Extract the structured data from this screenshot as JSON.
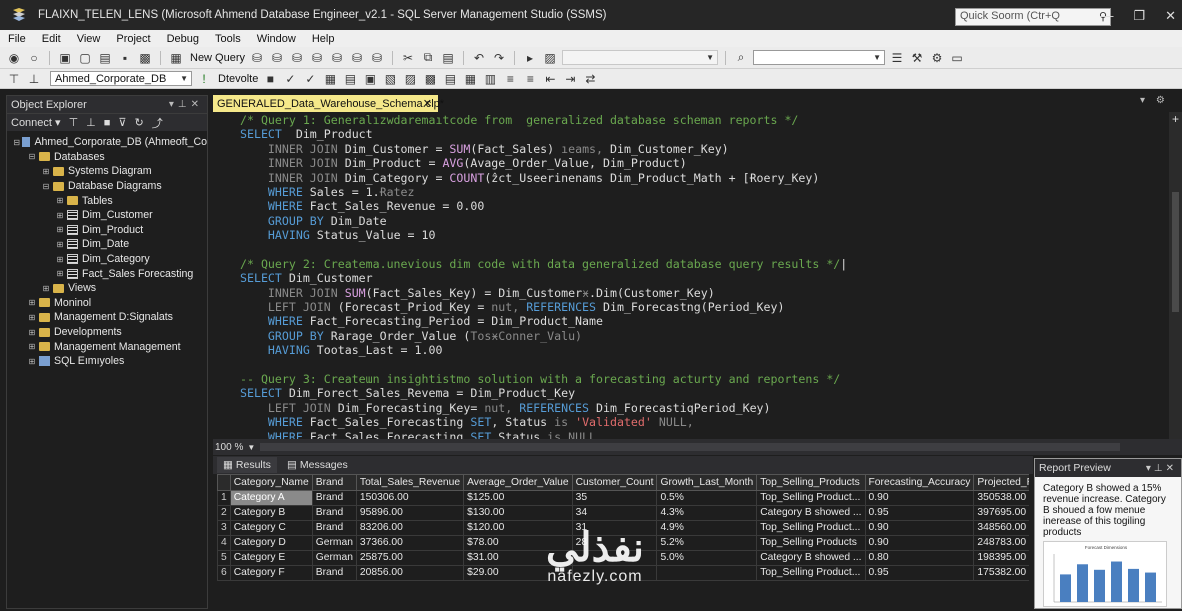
{
  "window": {
    "title": "FLAIXN_TELEN_LENS (Microsoft Ahmend Database Engineer_v2.1 - SQL Server Management Studio (SSMS)",
    "quick_launch_placeholder": "Quick Soorm (Ctr+Q",
    "controls": [
      "—",
      "❐",
      "✕"
    ]
  },
  "menu": [
    "File",
    "Edit",
    "View",
    "Project",
    "Debug",
    "Tools",
    "Window",
    "Help"
  ],
  "toolbar": {
    "new_query_label": "New Query",
    "database": "Ahmed_Corporate_DB",
    "execute_label": "Dtevolte"
  },
  "object_explorer": {
    "title": "Object Explorer",
    "connect_label": "Connect",
    "tree": [
      {
        "level": 0,
        "toggle": "⊟",
        "icon": "server",
        "label": "Ahmed_Corporate_DB (Ahmeoft_Co"
      },
      {
        "level": 1,
        "toggle": "⊟",
        "icon": "folder",
        "label": "Databases"
      },
      {
        "level": 2,
        "toggle": "⊞",
        "icon": "folder",
        "label": "Systems Diagram"
      },
      {
        "level": 2,
        "toggle": "⊟",
        "icon": "folder",
        "label": "Database Diagrams"
      },
      {
        "level": 3,
        "toggle": "⊞",
        "icon": "folder",
        "label": "Tables"
      },
      {
        "level": 3,
        "toggle": "⊞",
        "icon": "table",
        "label": "Dim_Customer"
      },
      {
        "level": 3,
        "toggle": "⊞",
        "icon": "table",
        "label": "Dim_Product"
      },
      {
        "level": 3,
        "toggle": "⊞",
        "icon": "table",
        "label": "Dim_Date"
      },
      {
        "level": 3,
        "toggle": "⊞",
        "icon": "table",
        "label": "Dim_Category"
      },
      {
        "level": 3,
        "toggle": "⊞",
        "icon": "table",
        "label": "Fact_Sales Forecasting"
      },
      {
        "level": 2,
        "toggle": "⊞",
        "icon": "folder",
        "label": "Views"
      },
      {
        "level": 1,
        "toggle": "⊞",
        "icon": "folder",
        "label": "Moninol"
      },
      {
        "level": 1,
        "toggle": "⊞",
        "icon": "folder",
        "label": "Management D:Signalats"
      },
      {
        "level": 1,
        "toggle": "⊞",
        "icon": "folder",
        "label": "Developments"
      },
      {
        "level": 1,
        "toggle": "⊞",
        "icon": "folder",
        "label": "Management Management"
      },
      {
        "level": 1,
        "toggle": "⊞",
        "icon": "sql",
        "label": "SQL Eımıyoles"
      }
    ]
  },
  "editor": {
    "tab_label": "GENERALED_Data_Warehouse_Schema.clp*",
    "tab_close": "✕",
    "zoom": "100 %",
    "lines": [
      [
        [
          "c-com",
          "/* Query 1: Generalızwdaremaıtcode from  generalized database scheman reports */"
        ]
      ],
      [
        [
          "c-kw",
          "SELECT"
        ],
        [
          "",
          "  Dim_Product"
        ]
      ],
      [
        [
          "",
          "    "
        ],
        [
          "c-gray",
          "INNER JOIN"
        ],
        [
          "",
          " Dim_Customer = "
        ],
        [
          "c-fn",
          "SUM"
        ],
        [
          "",
          "(Fact_Sales) "
        ],
        [
          "c-gray",
          "ıeams, "
        ],
        [
          "",
          "Dim_Customer_Key)"
        ]
      ],
      [
        [
          "",
          "    "
        ],
        [
          "c-gray",
          "INNER JOIN"
        ],
        [
          "",
          " Dim_Product = "
        ],
        [
          "c-fn",
          "AVG"
        ],
        [
          "",
          "(Avage_Order_Value, Dim_Product)"
        ]
      ],
      [
        [
          "",
          "    "
        ],
        [
          "c-gray",
          "INNER JOIN"
        ],
        [
          "",
          " Dim_Category = "
        ],
        [
          "c-fn",
          "COUNT"
        ],
        [
          "",
          "(ẑct_Useerinenams Dim_Product_Math + [Ɍoery_Key)"
        ]
      ],
      [
        [
          "",
          "    "
        ],
        [
          "c-kw",
          "WHERE"
        ],
        [
          "",
          " Sales = 1."
        ],
        [
          "c-gray",
          "Ɍatez"
        ]
      ],
      [
        [
          "",
          "    "
        ],
        [
          "c-kw",
          "WHERE"
        ],
        [
          "",
          " Fact_Sales_Revenue = 0.00"
        ]
      ],
      [
        [
          "",
          "    "
        ],
        [
          "c-kw",
          "GROUP BY"
        ],
        [
          "",
          " Dim_Date"
        ]
      ],
      [
        [
          "",
          "    "
        ],
        [
          "c-kw",
          "HAVING"
        ],
        [
          "",
          " Status_Value = 10"
        ]
      ],
      [
        [
          "",
          ""
        ]
      ],
      [
        [
          "c-com",
          "/* Query 2: Createma.unevious dim code with data generalized database query results */"
        ],
        [
          "",
          "|"
        ]
      ],
      [
        [
          "c-kw",
          "SELECT"
        ],
        [
          "",
          " Dim_Customer"
        ]
      ],
      [
        [
          "",
          "    "
        ],
        [
          "c-gray",
          "INNER JOIN"
        ],
        [
          "",
          " "
        ],
        [
          "c-fn",
          "SUM"
        ],
        [
          "",
          "(Fact_Sales_Key) = Dim_Customer"
        ],
        [
          "c-gray",
          "ӿ"
        ],
        [
          "",
          ".Dim(Customer_Key)"
        ]
      ],
      [
        [
          "",
          "    "
        ],
        [
          "c-gray",
          "LEFT JOIN"
        ],
        [
          "",
          " (Forecast_Priod_Key = "
        ],
        [
          "c-gray",
          "nut, "
        ],
        [
          "c-kw",
          "REFERENCES"
        ],
        [
          "",
          " Dim_Forecastng(Period_Key)"
        ]
      ],
      [
        [
          "",
          "    "
        ],
        [
          "c-kw",
          "WHERE"
        ],
        [
          "",
          " Fact_Forecasting_Period = Dim_Product_Name"
        ]
      ],
      [
        [
          "",
          "    "
        ],
        [
          "c-kw",
          "GROUP BY"
        ],
        [
          "",
          " Rarage_Order_Value ("
        ],
        [
          "c-gray",
          "Tos"
        ],
        [
          "c-gray",
          "ӿ"
        ],
        [
          "c-gray",
          "Conner_Valu)"
        ]
      ],
      [
        [
          "",
          "    "
        ],
        [
          "c-kw",
          "HAVING"
        ],
        [
          "",
          " Tootas_Last = 1.00"
        ]
      ],
      [
        [
          "",
          ""
        ]
      ],
      [
        [
          "c-com",
          "-- Query 3: Createɯn insightistmo solution with a forecasting acturty and reportens */"
        ]
      ],
      [
        [
          "c-kw",
          "SELECT"
        ],
        [
          "",
          " Dim_Forect_Sales_Revema = Dim_Product_Key"
        ]
      ],
      [
        [
          "",
          "    "
        ],
        [
          "c-gray",
          "LEFT JOIN"
        ],
        [
          "",
          " Dim_Forecasting_Key= "
        ],
        [
          "c-gray",
          "nut, "
        ],
        [
          "c-kw",
          "REFERENCES"
        ],
        [
          "",
          " Dim_ForecastiqPeriod_Key)"
        ]
      ],
      [
        [
          "",
          "    "
        ],
        [
          "c-kw",
          "WHERE"
        ],
        [
          "",
          " Fact_Sales_Forecasting "
        ],
        [
          "c-kw",
          "SET"
        ],
        [
          "",
          ", Status "
        ],
        [
          "c-gray",
          "is "
        ],
        [
          "c-str",
          "'Validated'"
        ],
        [
          "c-gray",
          " NULL,"
        ]
      ],
      [
        [
          "",
          "    "
        ],
        [
          "c-kw",
          "WHERE"
        ],
        [
          "",
          " Fact Sales Forecasting "
        ],
        [
          "c-kw",
          "SET"
        ],
        [
          "",
          " Status "
        ],
        [
          "c-gray",
          "is NULL"
        ]
      ]
    ]
  },
  "results": {
    "tabs": [
      "Results",
      "Messages"
    ],
    "columns": [
      "",
      "Category_Name",
      "Brand",
      "Total_Sales_Revenue",
      "Average_Order_Value",
      "Customer_Count",
      "Growth_Last_Month",
      "Top_Selling_Products",
      "Forecasting_Accuracy",
      "Projected_Revenue"
    ],
    "rows": [
      [
        "1",
        "Category A",
        "Brand",
        "150306.00",
        "$125.00",
        "35",
        "0.5%",
        "Top_Selling Product...",
        "0.90",
        "350538.00"
      ],
      [
        "2",
        "Category B",
        "Brand",
        "95896.00",
        "$130.00",
        "34",
        "4.3%",
        "Category B showed ...",
        "0.95",
        "397695.00"
      ],
      [
        "3",
        "Category C",
        "Brand",
        "83206.00",
        "$120.00",
        "31",
        "4.9%",
        "Top_Selling Product...",
        "0.90",
        "348560.00"
      ],
      [
        "4",
        "Category D",
        "German",
        "37366.00",
        "$78.00",
        "28",
        "5.2%",
        "Top_Selling Products",
        "0.90",
        "248783.00"
      ],
      [
        "5",
        "Category E",
        "German",
        "25875.00",
        "$31.00",
        "",
        "5.0%",
        "Category B showed ...",
        "0.80",
        "198395.00"
      ],
      [
        "6",
        "Category F",
        "Brand",
        "20856.00",
        "$29.00",
        "",
        "",
        "Top_Selling Product...",
        "0.95",
        "175382.00"
      ]
    ]
  },
  "report_preview": {
    "title": "Report Preview",
    "text": "Category B showed a 15% revenue increase. Category B shoued a fow menue inerease of this togiling products",
    "chart_title": "Forecast Dimensions",
    "chart_values": [
      60,
      82,
      70,
      88,
      72,
      64
    ]
  },
  "watermark": {
    "arabic": "نفذلي",
    "latin": "nafezly.com"
  }
}
